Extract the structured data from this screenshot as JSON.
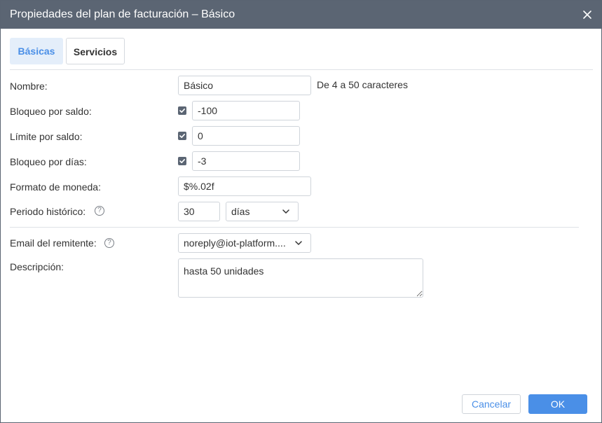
{
  "dialog": {
    "title": "Propiedades del plan de facturación – Básico"
  },
  "tabs": [
    {
      "label": "Básicas",
      "active": true
    },
    {
      "label": "Servicios",
      "active": false
    }
  ],
  "form": {
    "name": {
      "label": "Nombre:",
      "value": "Básico",
      "hint": "De 4 a 50 caracteres"
    },
    "balance_block": {
      "label": "Bloqueo por saldo:",
      "checked": true,
      "value": "-100"
    },
    "balance_limit": {
      "label": "Límite por saldo:",
      "checked": true,
      "value": "0"
    },
    "days_block": {
      "label": "Bloqueo por días:",
      "checked": true,
      "value": "-3"
    },
    "currency_format": {
      "label": "Formato de moneda:",
      "value": "$%.02f"
    },
    "history_period": {
      "label": "Periodo histórico:",
      "value": "30",
      "unit": "días"
    },
    "sender_email": {
      "label": "Email del remitente:",
      "value": "noreply@iot-platform...."
    },
    "description": {
      "label": "Descripción:",
      "value": "hasta 50 unidades"
    }
  },
  "buttons": {
    "cancel": "Cancelar",
    "ok": "OK"
  },
  "icons": {
    "close": "close-icon",
    "help": "help-icon",
    "chevron": "chevron-down-icon",
    "check": "check-icon"
  },
  "colors": {
    "titlebar": "#5b6573",
    "accent": "#4a8fe7",
    "active_tab_bg": "#e4eefa"
  }
}
